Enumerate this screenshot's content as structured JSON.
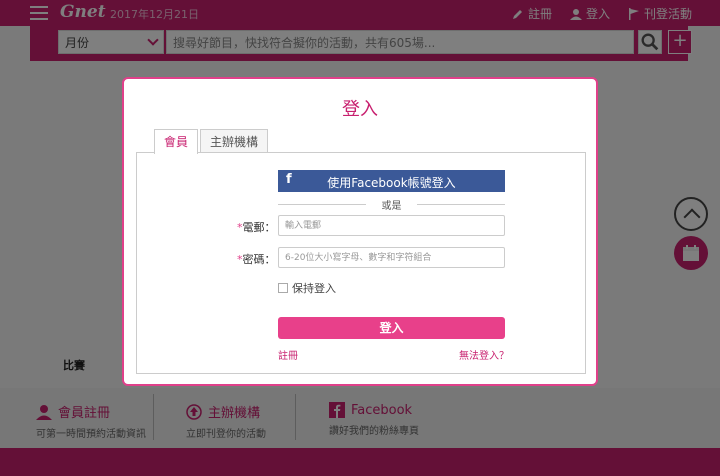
{
  "topbar": {
    "logo": "Gnet",
    "date": "2017年12月21日",
    "links": [
      {
        "label": "註冊",
        "icon": "pen-icon"
      },
      {
        "label": "登入",
        "icon": "user-icon"
      },
      {
        "label": "刊登活動",
        "icon": "flag-icon"
      }
    ]
  },
  "search": {
    "month": "月份",
    "placeholder": "搜尋好節目，快找符合擬你的活動，共有605場..."
  },
  "background": {
    "label": "比賽"
  },
  "footer": {
    "items": [
      {
        "title": "會員註冊",
        "sub": "可第一時間預約活動資訊",
        "icon": "user-icon"
      },
      {
        "title": "主辦機構",
        "sub": "立即刊登你的活動",
        "icon": "upload-icon"
      },
      {
        "title": "Facebook",
        "sub": "讚好我們的粉絲專頁",
        "icon": "facebook-icon"
      }
    ]
  },
  "modal": {
    "title": "登入",
    "tabs": [
      "會員",
      "主辦機構"
    ],
    "facebook_button": "使用Facebook帳號登入",
    "or": "或是",
    "email_label": "電郵：",
    "email_placeholder": "輸入電郵",
    "password_label": "密碼：",
    "password_placeholder": "6-20位大小寫字母、數字和字符組合",
    "required_mark": "*",
    "keep_login": "保持登入",
    "login_button": "登入",
    "register_link": "註冊",
    "forgot_link": "無法登入？"
  },
  "colors": {
    "brand": "#c8206f",
    "accent": "#e8408a",
    "facebook": "#3b5998"
  }
}
